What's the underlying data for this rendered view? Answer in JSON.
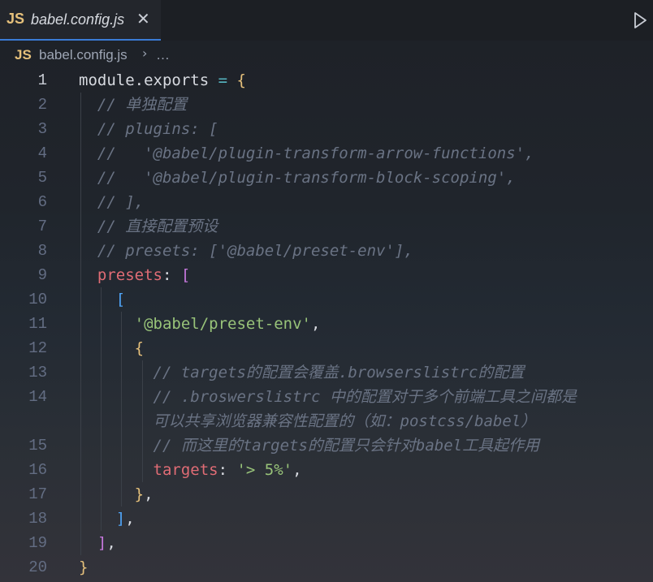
{
  "tab": {
    "badge": "JS",
    "title": "babel.config.js",
    "close": "✕"
  },
  "breadcrumb": {
    "badge": "JS",
    "file": "babel.config.js",
    "separator": "›",
    "more": "…"
  },
  "lines": [
    {
      "n": "1",
      "parts": [
        {
          "t": "module.exports",
          "c": "plain"
        },
        {
          "t": " = ",
          "c": "op"
        },
        {
          "t": "{",
          "c": "yellow"
        }
      ]
    },
    {
      "n": "2",
      "parts": [
        {
          "t": "  // 单独配置",
          "c": "comment"
        }
      ]
    },
    {
      "n": "3",
      "parts": [
        {
          "t": "  // plugins: [",
          "c": "comment"
        }
      ]
    },
    {
      "n": "4",
      "parts": [
        {
          "t": "  //   '@babel/plugin-transform-arrow-functions',",
          "c": "comment"
        }
      ]
    },
    {
      "n": "5",
      "parts": [
        {
          "t": "  //   '@babel/plugin-transform-block-scoping',",
          "c": "comment"
        }
      ]
    },
    {
      "n": "6",
      "parts": [
        {
          "t": "  // ],",
          "c": "comment"
        }
      ]
    },
    {
      "n": "7",
      "parts": [
        {
          "t": "  // 直接配置预设",
          "c": "comment"
        }
      ]
    },
    {
      "n": "8",
      "parts": [
        {
          "t": "  // presets: ['@babel/preset-env'],",
          "c": "comment"
        }
      ]
    },
    {
      "n": "9",
      "parts": [
        {
          "t": "  ",
          "c": "plain"
        },
        {
          "t": "presets",
          "c": "key"
        },
        {
          "t": ": ",
          "c": "plain"
        },
        {
          "t": "[",
          "c": "purple"
        }
      ]
    },
    {
      "n": "10",
      "parts": [
        {
          "t": "    ",
          "c": "plain"
        },
        {
          "t": "[",
          "c": "blue"
        }
      ]
    },
    {
      "n": "11",
      "parts": [
        {
          "t": "      ",
          "c": "plain"
        },
        {
          "t": "'@babel/preset-env'",
          "c": "str"
        },
        {
          "t": ",",
          "c": "plain"
        }
      ]
    },
    {
      "n": "12",
      "parts": [
        {
          "t": "      ",
          "c": "plain"
        },
        {
          "t": "{",
          "c": "yellow"
        }
      ]
    },
    {
      "n": "13",
      "parts": [
        {
          "t": "        // targets的配置会覆盖.browserslistrc的配置",
          "c": "comment"
        }
      ]
    },
    {
      "n": "14",
      "parts": [
        {
          "t": "        // .broswerslistrc 中的配置对于多个前端工具之间都是",
          "c": "comment"
        }
      ]
    },
    {
      "n": "",
      "parts": [
        {
          "t": "        可以共享浏览器兼容性配置的（如：postcss/babel）",
          "c": "comment"
        }
      ]
    },
    {
      "n": "15",
      "parts": [
        {
          "t": "        // 而这里的targets的配置只会针对babel工具起作用",
          "c": "comment"
        }
      ]
    },
    {
      "n": "16",
      "parts": [
        {
          "t": "        ",
          "c": "plain"
        },
        {
          "t": "targets",
          "c": "key"
        },
        {
          "t": ": ",
          "c": "plain"
        },
        {
          "t": "'> 5%'",
          "c": "str"
        },
        {
          "t": ",",
          "c": "plain"
        }
      ]
    },
    {
      "n": "17",
      "parts": [
        {
          "t": "      ",
          "c": "plain"
        },
        {
          "t": "}",
          "c": "yellow"
        },
        {
          "t": ",",
          "c": "plain"
        }
      ]
    },
    {
      "n": "18",
      "parts": [
        {
          "t": "    ",
          "c": "plain"
        },
        {
          "t": "]",
          "c": "blue"
        },
        {
          "t": ",",
          "c": "plain"
        }
      ]
    },
    {
      "n": "19",
      "parts": [
        {
          "t": "  ",
          "c": "plain"
        },
        {
          "t": "]",
          "c": "purple"
        },
        {
          "t": ",",
          "c": "plain"
        }
      ]
    },
    {
      "n": "20",
      "parts": [
        {
          "t": "}",
          "c": "yellow"
        }
      ]
    }
  ],
  "icons": {
    "run": "run-icon",
    "close": "close-icon"
  }
}
